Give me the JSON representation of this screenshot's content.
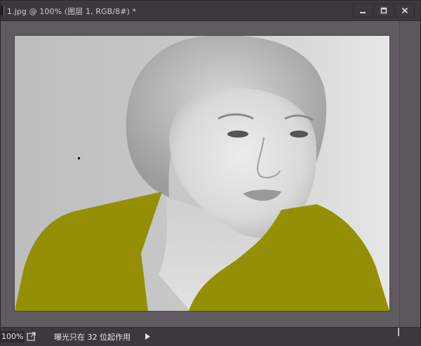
{
  "window": {
    "title": "1.jpg @ 100% (图层 1, RGB/8#) *",
    "controls": [
      "minimize-icon",
      "restore-icon",
      "close-icon"
    ]
  },
  "statusbar": {
    "zoom": "100%",
    "message": "曝光只在 32 位起作用",
    "icons": [
      "export-icon",
      "play-arrow-icon"
    ]
  },
  "colors": {
    "overlay": "#958f06",
    "chrome": "#3c393d",
    "canvas": "#5f5b60"
  }
}
